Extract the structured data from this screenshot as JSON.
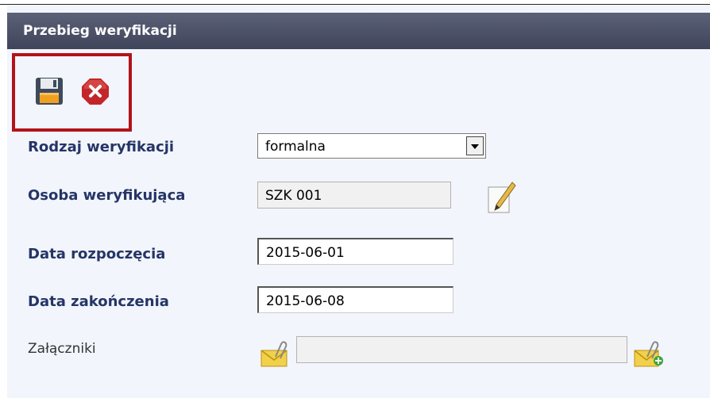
{
  "panel": {
    "title": "Przebieg weryfikacji"
  },
  "toolbar": {
    "save_icon": "save-icon",
    "cancel_icon": "cancel-icon"
  },
  "form": {
    "rodzaj": {
      "label": "Rodzaj weryfikacji",
      "value": "formalna"
    },
    "osoba": {
      "label": "Osoba weryfikująca",
      "value": "SZK 001",
      "edit_icon": "pencil-icon"
    },
    "data_rozpoczecia": {
      "label": "Data rozpoczęcia",
      "value": "2015-06-01"
    },
    "data_zakonczenia": {
      "label": "Data zakończenia",
      "value": "2015-06-08"
    },
    "zalaczniki": {
      "label": "Załączniki",
      "value": "",
      "attach_icon": "attachment-icon",
      "add_attach_icon": "add-attachment-icon"
    }
  },
  "colors": {
    "header": "#4a4f66",
    "label": "#253566",
    "highlight": "#b3121a",
    "background": "#f2f5fb"
  }
}
